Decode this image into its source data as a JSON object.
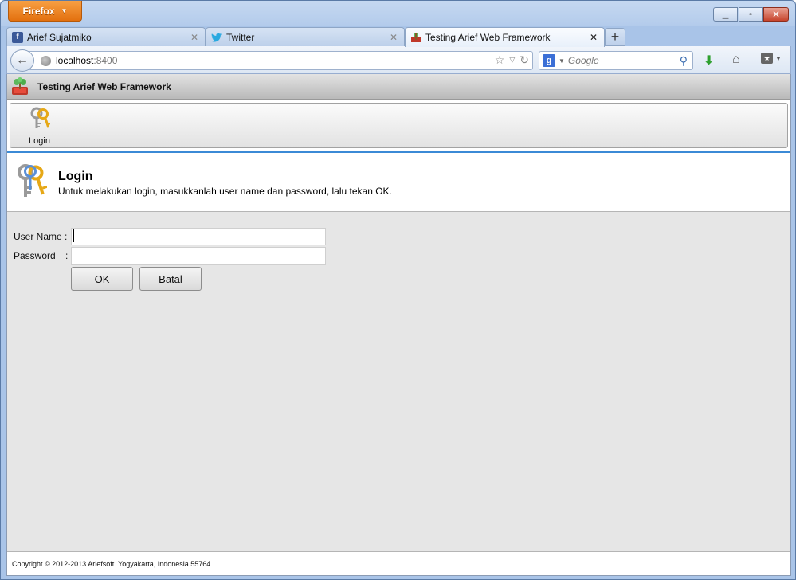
{
  "browser": {
    "menu_button": "Firefox",
    "tabs": [
      {
        "label": "Arief Sujatmiko",
        "icon": "facebook-icon"
      },
      {
        "label": "Twitter",
        "icon": "twitter-icon"
      },
      {
        "label": "Testing Arief Web Framework",
        "icon": "app-favicon"
      }
    ],
    "url_host": "localhost",
    "url_port": ":8400",
    "search_placeholder": "Google"
  },
  "app": {
    "title": "Testing Arief Web Framework",
    "toolbar": {
      "login_label": "Login"
    },
    "info": {
      "title": "Login",
      "description": "Untuk melakukan login, masukkanlah user name dan password, lalu tekan OK."
    },
    "form": {
      "username_label": "User Name :",
      "password_label": "Password",
      "password_colon": ":",
      "username_value": "",
      "password_value": "",
      "ok_label": "OK",
      "cancel_label": "Batal"
    },
    "footer": "Copyright © 2012-2013 Ariefsoft. Yogyakarta, Indonesia 55764."
  },
  "colors": {
    "accent_line": "#3b8ad6",
    "form_background": "#e6e6e6",
    "firefox_orange": "#e3700f"
  }
}
